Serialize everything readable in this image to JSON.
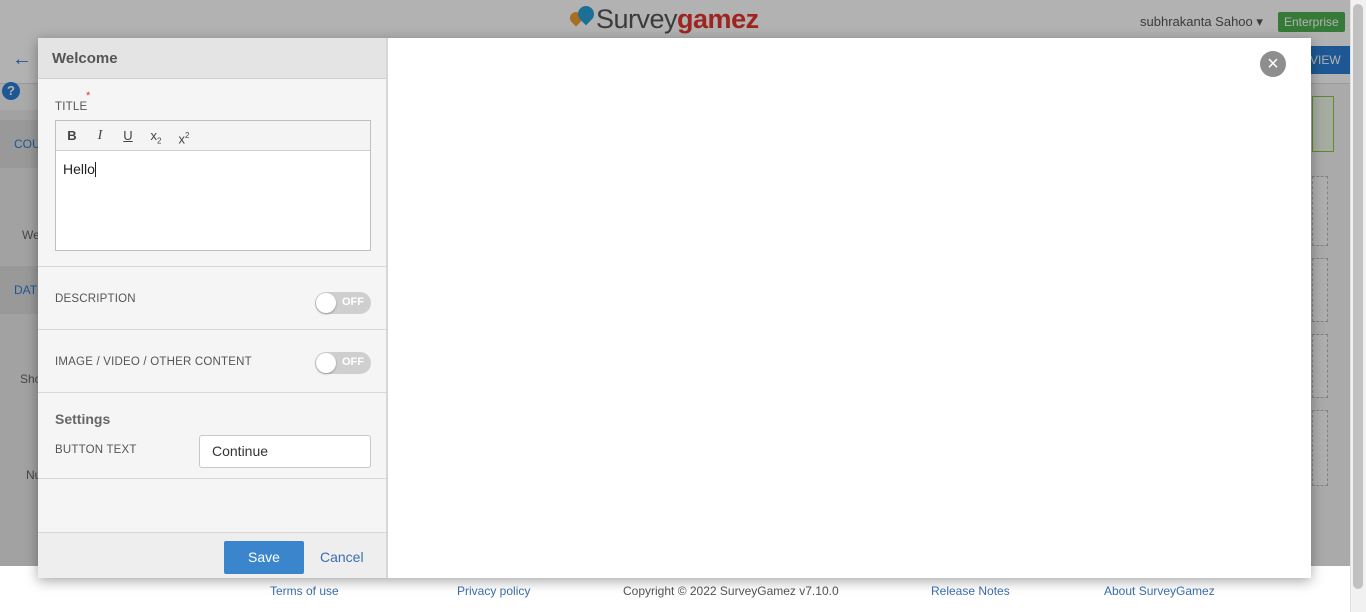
{
  "app": {
    "logo_part1": "Survey",
    "logo_part2": "gamez",
    "user_name": "subhrakanta Sahoo",
    "user_caret": "▾",
    "plan_badge": "Enterprise",
    "back_icon": "←",
    "help_icon": "?",
    "preview_fragment": "VIEW",
    "left_panel_labels": [
      "COU",
      "We",
      "DAT",
      "Sho",
      "Nu"
    ]
  },
  "footer": {
    "terms": "Terms of use",
    "privacy": "Privacy policy",
    "copyright": "Copyright ©  2022 SurveyGamez v7.10.0",
    "release_notes": "Release Notes",
    "about": "About SurveyGamez"
  },
  "modal": {
    "title": "Welcome",
    "title_label": "TITLE",
    "required_mark": "*",
    "rte_toolbar": {
      "bold": "B",
      "italic": "I",
      "underline": "U",
      "subscript": "x",
      "subscript_mark": "2",
      "superscript": "x",
      "superscript_mark": "2"
    },
    "title_value": "Hello",
    "description_label": "DESCRIPTION",
    "description_toggle": "OFF",
    "media_label": "IMAGE / VIDEO / OTHER CONTENT",
    "media_toggle": "OFF",
    "settings_heading": "Settings",
    "button_text_label": "BUTTON TEXT",
    "button_text_value": "Continue",
    "save_label": "Save",
    "cancel_label": "Cancel",
    "close_icon": "×"
  },
  "colors": {
    "primary": "#3a85cc",
    "link": "#3a6fb0",
    "plan_badge": "#4caf50",
    "required": "#e3342f"
  }
}
